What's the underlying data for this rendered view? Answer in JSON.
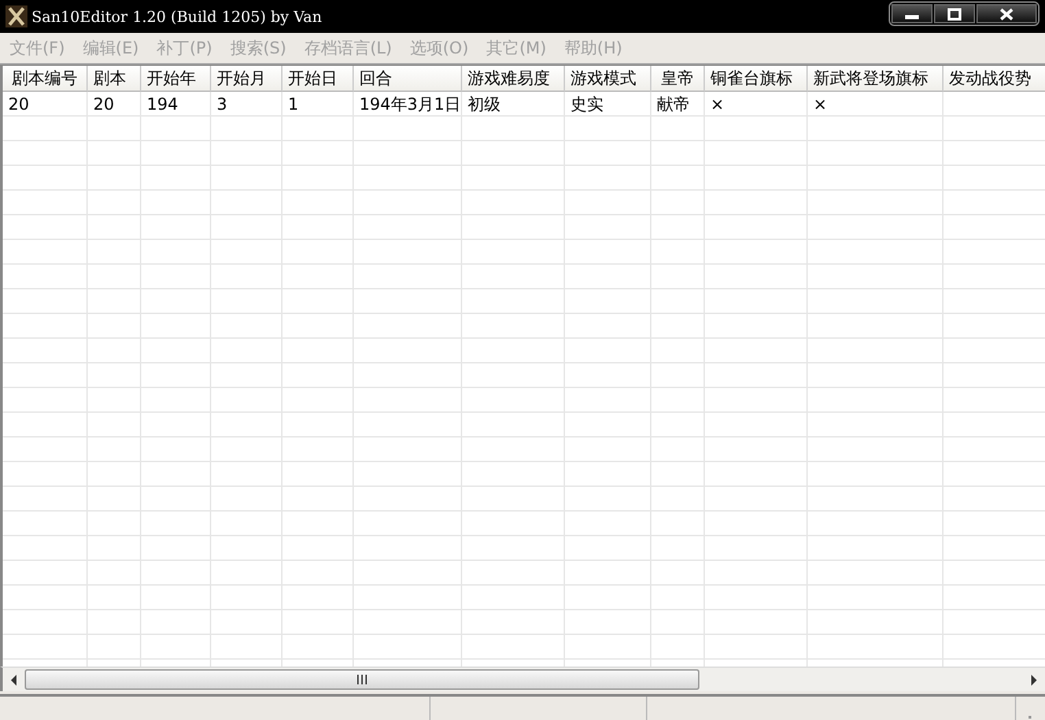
{
  "window": {
    "title": "San10Editor 1.20 (Build 1205) by Van"
  },
  "menu": [
    {
      "label": "文件(F)",
      "disabled": true
    },
    {
      "label": "编辑(E)",
      "disabled": true
    },
    {
      "label": "补丁(P)",
      "disabled": true
    },
    {
      "label": "搜索(S)",
      "disabled": true
    },
    {
      "label": "存档语言(L)",
      "disabled": true
    },
    {
      "label": "选项(O)",
      "disabled": true
    },
    {
      "label": "其它(M)",
      "disabled": true
    },
    {
      "label": "帮助(H)",
      "disabled": true
    }
  ],
  "table": {
    "columns": [
      "剧本编号",
      "剧本",
      "开始年",
      "开始月",
      "开始日",
      "回合",
      "游戏难易度",
      "游戏模式",
      "皇帝",
      "铜雀台旗标",
      "新武将登场旗标",
      "发动战役势"
    ],
    "rows": [
      [
        "20",
        "20",
        "194",
        "3",
        "1",
        "194年3月1日",
        "初级",
        "史实",
        "献帝",
        "×",
        "×",
        ""
      ]
    ]
  }
}
